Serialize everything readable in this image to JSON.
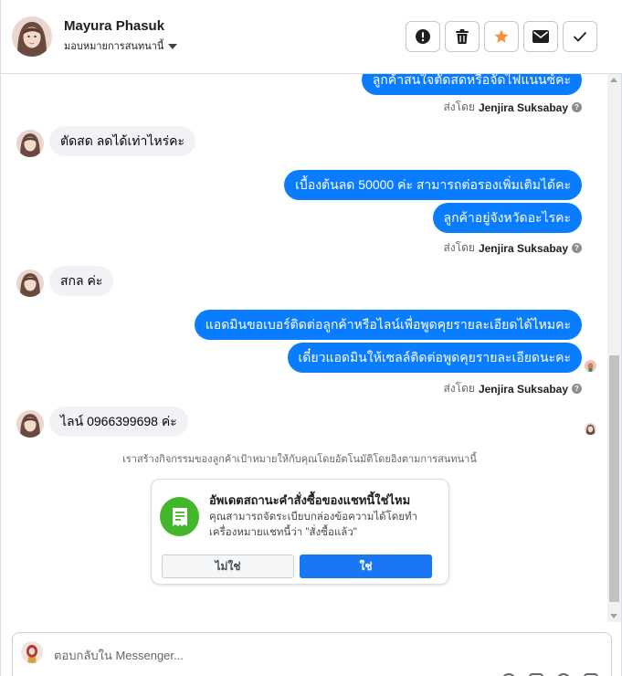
{
  "header": {
    "name": "Mayura Phasuk",
    "assign_label": "มอบหมายการสนทนานี้",
    "actions": [
      {
        "icon": "alert-icon"
      },
      {
        "icon": "trash-icon"
      },
      {
        "icon": "star-icon"
      },
      {
        "icon": "envelope-icon"
      },
      {
        "icon": "check-icon"
      }
    ]
  },
  "messages": {
    "m0": "ลูกค้าสนใจตัดสดหรือจัดไฟแนนซ์คะ",
    "m1": "ตัดสด ลดได้เท่าไหร่คะ",
    "m2": "เบื้องต้นลด 50000 ค่ะ สามารถต่อรองเพิ่มเติมได้คะ",
    "m3": "ลูกค้าอยู่จังหวัดอะไรคะ",
    "m4": "สกล ค่ะ",
    "m5": "แอดมินขอเบอร์ติดต่อลูกค้าหรือไลน์เพื่อพูดคุยรายละเอียดได้ไหมคะ",
    "m6": "เดี๋ยวแอดมินให้เซลล์ติดต่อพูดคุยรายละเอียดนะคะ",
    "m7": "ไลน์ 0966399698 ค่ะ"
  },
  "sent_by": {
    "prefix": "ส่งโดย",
    "agent": "Jenjira Suksabay"
  },
  "auto_note": "เราสร้างกิจกรรมของลูกค้าเป้าหมายให้กับคุณโดยอัตโนมัติโดยอิงตามการสนทนานี้",
  "card": {
    "title": "อัพเดตสถานะคำสั่งซื้อของแชทนี้ใช่ไหม",
    "body": "คุณสามารถจัดระเบียบกล่องข้อความได้โดยทำเครื่องหมายแชทนี้ว่า \"สั่งซื้อแล้ว\"",
    "no_label": "ไม่ใช่",
    "yes_label": "ใช่",
    "icon": "order-receipt-icon"
  },
  "composer": {
    "placeholder": "ตอบกลับใน Messenger..."
  },
  "colors": {
    "outgoing_bubble": "#0a7cff",
    "incoming_bubble": "#f0f2f5",
    "primary_button": "#1877f2",
    "star": "#f7923b",
    "card_icon_bg": "#42b72a"
  }
}
